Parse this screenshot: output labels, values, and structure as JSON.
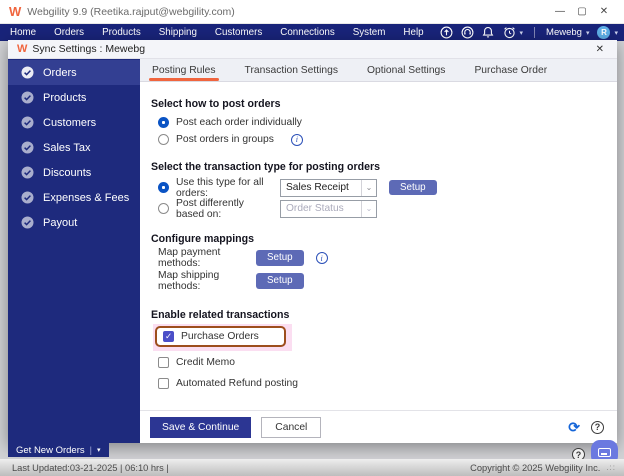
{
  "window": {
    "title": "Webgility 9.9 (Reetika.rajput@webgility.com)",
    "logo": "W"
  },
  "menubar": {
    "items": [
      "Home",
      "Orders",
      "Products",
      "Shipping",
      "Customers",
      "Connections",
      "System",
      "Help"
    ],
    "account": "Mewebg",
    "avatar": "R"
  },
  "dialog": {
    "title": "Sync Settings : Mewebg",
    "sidebar": [
      {
        "label": "Orders"
      },
      {
        "label": "Products"
      },
      {
        "label": "Customers"
      },
      {
        "label": "Sales Tax"
      },
      {
        "label": "Discounts"
      },
      {
        "label": "Expenses & Fees"
      },
      {
        "label": "Payout"
      }
    ],
    "tabs": [
      {
        "label": "Posting Rules"
      },
      {
        "label": "Transaction Settings"
      },
      {
        "label": "Optional Settings"
      },
      {
        "label": "Purchase Order"
      }
    ],
    "post_orders": {
      "heading": "Select how to post orders",
      "option1": "Post each order individually",
      "option2": "Post orders in groups"
    },
    "transaction_type": {
      "heading": "Select the transaction type for posting orders",
      "option1_label": "Use this type for all orders:",
      "option1_value": "Sales Receipt",
      "option2_label": "Post differently based on:",
      "option2_value": "Order Status",
      "setup": "Setup"
    },
    "mappings": {
      "heading": "Configure mappings",
      "payment_label": "Map payment methods:",
      "shipping_label": "Map shipping methods:",
      "setup": "Setup"
    },
    "related": {
      "heading": "Enable related transactions",
      "purchase_orders": "Purchase Orders",
      "credit_memo": "Credit Memo",
      "auto_refund": "Automated Refund posting"
    },
    "footer": {
      "save": "Save & Continue",
      "cancel": "Cancel"
    }
  },
  "bottom": {
    "get_new_orders": "Get New Orders"
  },
  "statusbar": {
    "last_updated": "Last Updated:03-21-2025 | 06:10 hrs |",
    "copyright": "Copyright © 2025 Webgility Inc."
  },
  "glyphs": {
    "minimize": "—",
    "maximize": "▢",
    "close": "✕",
    "caret_down": "▾",
    "dd_caret": "⌄",
    "info": "i",
    "help": "?",
    "refresh": "⟳",
    "pipe": "|",
    "grip": ".::"
  },
  "colors": {
    "navy": "#1e2a7d",
    "menubar_navy": "#19247a",
    "selected_item": "#333f92",
    "accent_orange": "#f0653e",
    "setup_button": "#5d6ab6",
    "save_button": "#2c3693",
    "radio_blue": "#0a53c4",
    "checkbox_indigo": "#4b4fc8",
    "annotation_border": "#9d4e1d",
    "annotation_pink": "#fbdef1",
    "chat_icon": "#6b79e0"
  }
}
